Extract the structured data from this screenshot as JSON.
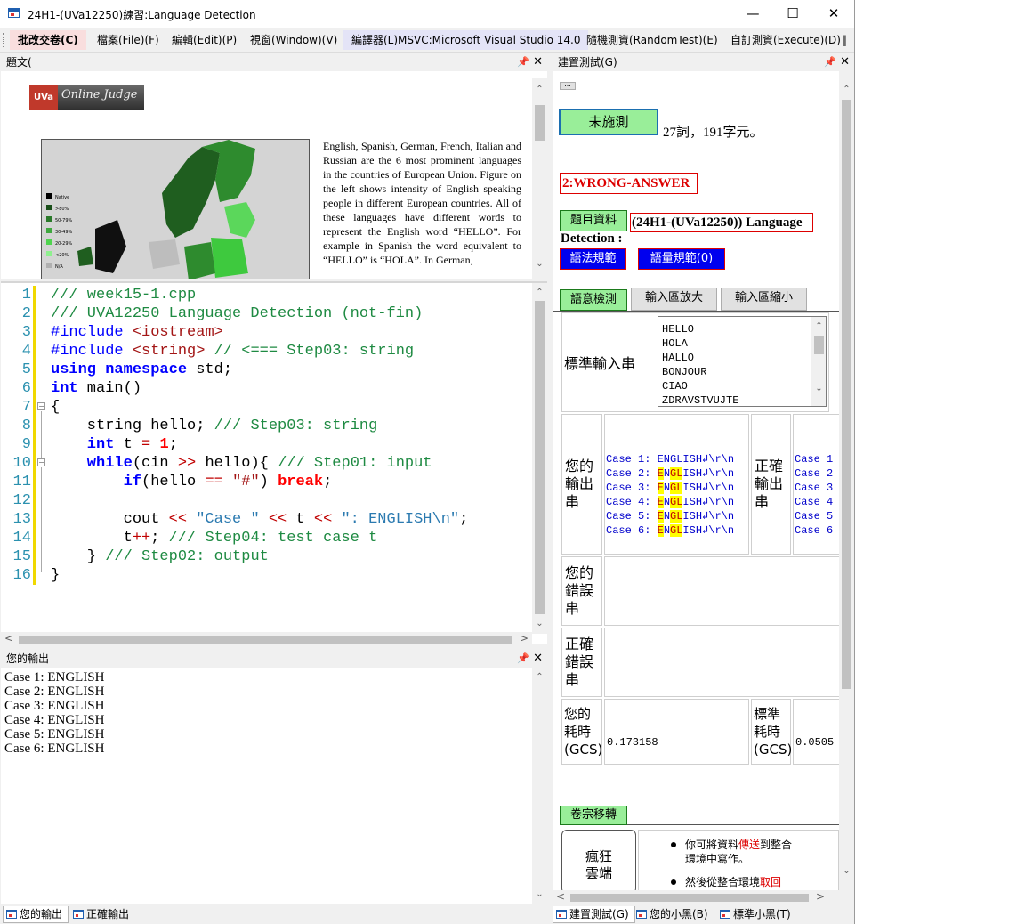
{
  "window": {
    "title": "24H1-(UVa12250)練習:Language Detection",
    "minimize": "—",
    "maximize": "☐",
    "close": "✕"
  },
  "menu": {
    "items": [
      {
        "label": "批改交卷(C)"
      },
      {
        "label": "檔案(File)(F)"
      },
      {
        "label": "編輯(Edit)(P)"
      },
      {
        "label": "視窗(Window)(V)"
      },
      {
        "label": "編譯器(L)MSVC:Microsoft Visual Studio 14.0"
      },
      {
        "label": "隨機測資(RandomTest)(E)"
      },
      {
        "label": "自訂測資(Execute)(D)"
      },
      {
        "label": "‖"
      }
    ]
  },
  "problem_panel": {
    "title": "題文(",
    "logo_uva": "UVa",
    "logo_text": "Online Judge",
    "legend": [
      "Native",
      ">80%",
      "50-79%",
      "30-49%",
      "20-29%",
      "<20%",
      "N/A"
    ],
    "text": "English, Spanish, German, French, Italian and Russian are the 6 most prominent languages in the countries of European Union. Figure on the left shows intensity of English speaking people in different European countries. All of these languages have different words to represent the English word “HELLO”. For example in Spanish the word equivalent to “HELLO” is “HOLA”. In German,"
  },
  "editor": {
    "line_numbers": [
      "1",
      "2",
      "3",
      "4",
      "5",
      "6",
      "7",
      "8",
      "9",
      "10",
      "11",
      "12",
      "13",
      "14",
      "15",
      "16"
    ],
    "l1": "/// week15-1.cpp",
    "l2": "/// UVA12250 Language Detection (not-fin)",
    "l3a": "#include ",
    "l3b": "<iostream>",
    "l4a": "#include ",
    "l4b": "<string>",
    "l4c": " // <=== Step03: string",
    "l5a": "using namespace",
    "l5b": " std;",
    "l6a": "int",
    "l6b": " main()",
    "l7": "{",
    "l8a": "    string hello; ",
    "l8b": "/// Step03: string",
    "l9a": "    int",
    "l9b": " t ",
    "l9c": "=",
    "l9d": " ",
    "l9e": "1",
    "l9f": ";",
    "l10a": "    while",
    "l10b": "(cin ",
    "l10c": ">>",
    "l10d": " hello){ ",
    "l10e": "/// Step01: input",
    "l11a": "        if",
    "l11b": "(hello ",
    "l11c": "==",
    "l11d": " ",
    "l11e": "\"#\"",
    "l11f": ") ",
    "l11g": "break",
    "l11h": ";",
    "l12": "",
    "l13a": "        cout ",
    "l13b": "<<",
    "l13c": " ",
    "l13d": "\"Case \"",
    "l13e": " ",
    "l13f": "<<",
    "l13g": " t ",
    "l13h": "<<",
    "l13i": " ",
    "l13j": "\": ENGLISH\\n\"",
    "l13k": ";",
    "l14a": "        t",
    "l14b": "++",
    "l14c": "; ",
    "l14d": "/// Step04: test case t",
    "l15a": "    } ",
    "l15b": "/// Step02: output",
    "l16": "}"
  },
  "output_panel": {
    "title": "您的輸出",
    "lines": [
      "Case 1: ENGLISH",
      "Case 2: ENGLISH",
      "Case 3: ENGLISH",
      "Case 4: ENGLISH",
      "Case 5: ENGLISH",
      "Case 6: ENGLISH"
    ]
  },
  "left_tabs": [
    {
      "label": "您的輸出"
    },
    {
      "label": "正確輸出"
    }
  ],
  "right_panel": {
    "title": "建置測試(G)",
    "small_btn": "...",
    "test_btn": "未施測",
    "word_count": "27詞，191字元。",
    "result": "2:WRONG-ANSWER",
    "problem_info_btn": "題目資料",
    "problem_name": "(24H1-(UVa12250)) Language",
    "problem_name_cont": "Detection :",
    "grammar_btn": "語法規範",
    "volume_btn": "語量規範(0)",
    "semantic_btn": "語意檢測",
    "enlarge_btn": "輸入區放大",
    "shrink_btn": "輸入區縮小",
    "stdin_label": "標準輸入串",
    "stdin_lines": [
      "HELLO",
      "HOLA",
      "HALLO",
      "BONJOUR",
      "CIAO",
      "ZDRAVSTVUJTE"
    ],
    "your_output_label": "您的輸出串",
    "your_output": [
      {
        "pre": "Case 1: ",
        "hl": "",
        "post": "ENGLISH↲\\r\\n"
      },
      {
        "pre": "Case 2: ",
        "hl": "E",
        "mid": "N",
        "hl2": "GL",
        "post": "ISH↲\\r\\n"
      },
      {
        "pre": "Case 3: ",
        "hl": "E",
        "mid": "N",
        "hl2": "GL",
        "post": "ISH↲\\r\\n"
      },
      {
        "pre": "Case 4: ",
        "hl": "E",
        "mid": "N",
        "hl2": "GL",
        "post": "ISH↲\\r\\n"
      },
      {
        "pre": "Case 5: ",
        "hl": "E",
        "mid": "N",
        "hl2": "GL",
        "post": "ISH↲\\r\\n"
      },
      {
        "pre": "Case 6: ",
        "hl": "E",
        "mid": "N",
        "hl2": "GL",
        "post": "ISH↲\\r\\n"
      }
    ],
    "correct_output_label": "正確輸出串",
    "correct_output": [
      "Case 1",
      "Case 2",
      "Case 3",
      "Case 4",
      "Case 5",
      "Case 6"
    ],
    "your_error_label": "您的錯誤串",
    "correct_error_label": "正確錯誤串",
    "your_time_label": "您的耗時(GCS)",
    "your_time": "0.173158",
    "std_time_label": "標準耗時(GCS)",
    "std_time": "0.0505",
    "transfer_btn": "卷宗移轉",
    "cloud_btn": "瘋狂雲端",
    "bullet1_a": "你可將資料",
    "bullet1_b": "傳送",
    "bullet1_c": "到整合環境中寫作。",
    "bullet2_a": "然後從整合環境",
    "bullet2_b": "取回"
  },
  "right_tabs": [
    {
      "label": "建置測試(G)"
    },
    {
      "label": "您的小黑(B)"
    },
    {
      "label": "標準小黑(T)"
    }
  ]
}
